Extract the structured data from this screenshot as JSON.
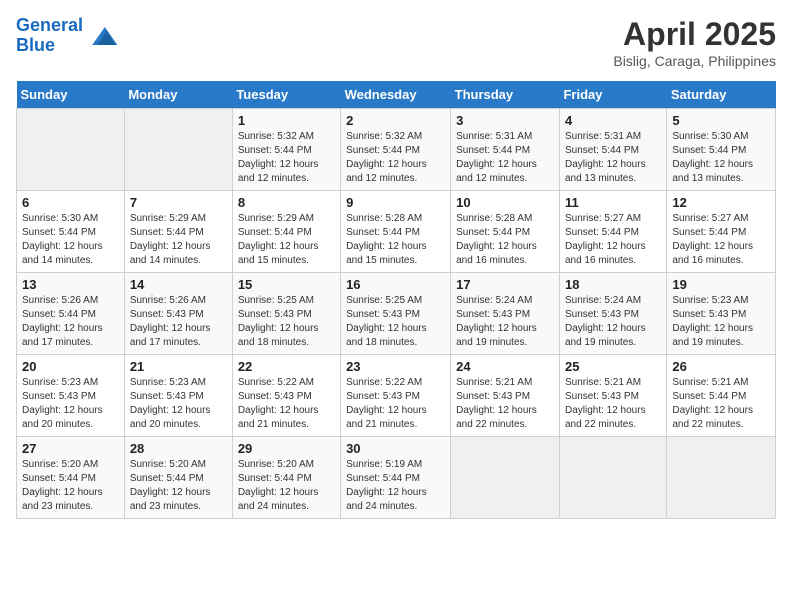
{
  "header": {
    "logo_line1": "General",
    "logo_line2": "Blue",
    "month": "April 2025",
    "location": "Bislig, Caraga, Philippines"
  },
  "days_of_week": [
    "Sunday",
    "Monday",
    "Tuesday",
    "Wednesday",
    "Thursday",
    "Friday",
    "Saturday"
  ],
  "weeks": [
    [
      {
        "day": "",
        "info": ""
      },
      {
        "day": "",
        "info": ""
      },
      {
        "day": "1",
        "info": "Sunrise: 5:32 AM\nSunset: 5:44 PM\nDaylight: 12 hours and 12 minutes."
      },
      {
        "day": "2",
        "info": "Sunrise: 5:32 AM\nSunset: 5:44 PM\nDaylight: 12 hours and 12 minutes."
      },
      {
        "day": "3",
        "info": "Sunrise: 5:31 AM\nSunset: 5:44 PM\nDaylight: 12 hours and 12 minutes."
      },
      {
        "day": "4",
        "info": "Sunrise: 5:31 AM\nSunset: 5:44 PM\nDaylight: 12 hours and 13 minutes."
      },
      {
        "day": "5",
        "info": "Sunrise: 5:30 AM\nSunset: 5:44 PM\nDaylight: 12 hours and 13 minutes."
      }
    ],
    [
      {
        "day": "6",
        "info": "Sunrise: 5:30 AM\nSunset: 5:44 PM\nDaylight: 12 hours and 14 minutes."
      },
      {
        "day": "7",
        "info": "Sunrise: 5:29 AM\nSunset: 5:44 PM\nDaylight: 12 hours and 14 minutes."
      },
      {
        "day": "8",
        "info": "Sunrise: 5:29 AM\nSunset: 5:44 PM\nDaylight: 12 hours and 15 minutes."
      },
      {
        "day": "9",
        "info": "Sunrise: 5:28 AM\nSunset: 5:44 PM\nDaylight: 12 hours and 15 minutes."
      },
      {
        "day": "10",
        "info": "Sunrise: 5:28 AM\nSunset: 5:44 PM\nDaylight: 12 hours and 16 minutes."
      },
      {
        "day": "11",
        "info": "Sunrise: 5:27 AM\nSunset: 5:44 PM\nDaylight: 12 hours and 16 minutes."
      },
      {
        "day": "12",
        "info": "Sunrise: 5:27 AM\nSunset: 5:44 PM\nDaylight: 12 hours and 16 minutes."
      }
    ],
    [
      {
        "day": "13",
        "info": "Sunrise: 5:26 AM\nSunset: 5:44 PM\nDaylight: 12 hours and 17 minutes."
      },
      {
        "day": "14",
        "info": "Sunrise: 5:26 AM\nSunset: 5:43 PM\nDaylight: 12 hours and 17 minutes."
      },
      {
        "day": "15",
        "info": "Sunrise: 5:25 AM\nSunset: 5:43 PM\nDaylight: 12 hours and 18 minutes."
      },
      {
        "day": "16",
        "info": "Sunrise: 5:25 AM\nSunset: 5:43 PM\nDaylight: 12 hours and 18 minutes."
      },
      {
        "day": "17",
        "info": "Sunrise: 5:24 AM\nSunset: 5:43 PM\nDaylight: 12 hours and 19 minutes."
      },
      {
        "day": "18",
        "info": "Sunrise: 5:24 AM\nSunset: 5:43 PM\nDaylight: 12 hours and 19 minutes."
      },
      {
        "day": "19",
        "info": "Sunrise: 5:23 AM\nSunset: 5:43 PM\nDaylight: 12 hours and 19 minutes."
      }
    ],
    [
      {
        "day": "20",
        "info": "Sunrise: 5:23 AM\nSunset: 5:43 PM\nDaylight: 12 hours and 20 minutes."
      },
      {
        "day": "21",
        "info": "Sunrise: 5:23 AM\nSunset: 5:43 PM\nDaylight: 12 hours and 20 minutes."
      },
      {
        "day": "22",
        "info": "Sunrise: 5:22 AM\nSunset: 5:43 PM\nDaylight: 12 hours and 21 minutes."
      },
      {
        "day": "23",
        "info": "Sunrise: 5:22 AM\nSunset: 5:43 PM\nDaylight: 12 hours and 21 minutes."
      },
      {
        "day": "24",
        "info": "Sunrise: 5:21 AM\nSunset: 5:43 PM\nDaylight: 12 hours and 22 minutes."
      },
      {
        "day": "25",
        "info": "Sunrise: 5:21 AM\nSunset: 5:43 PM\nDaylight: 12 hours and 22 minutes."
      },
      {
        "day": "26",
        "info": "Sunrise: 5:21 AM\nSunset: 5:44 PM\nDaylight: 12 hours and 22 minutes."
      }
    ],
    [
      {
        "day": "27",
        "info": "Sunrise: 5:20 AM\nSunset: 5:44 PM\nDaylight: 12 hours and 23 minutes."
      },
      {
        "day": "28",
        "info": "Sunrise: 5:20 AM\nSunset: 5:44 PM\nDaylight: 12 hours and 23 minutes."
      },
      {
        "day": "29",
        "info": "Sunrise: 5:20 AM\nSunset: 5:44 PM\nDaylight: 12 hours and 24 minutes."
      },
      {
        "day": "30",
        "info": "Sunrise: 5:19 AM\nSunset: 5:44 PM\nDaylight: 12 hours and 24 minutes."
      },
      {
        "day": "",
        "info": ""
      },
      {
        "day": "",
        "info": ""
      },
      {
        "day": "",
        "info": ""
      }
    ]
  ]
}
